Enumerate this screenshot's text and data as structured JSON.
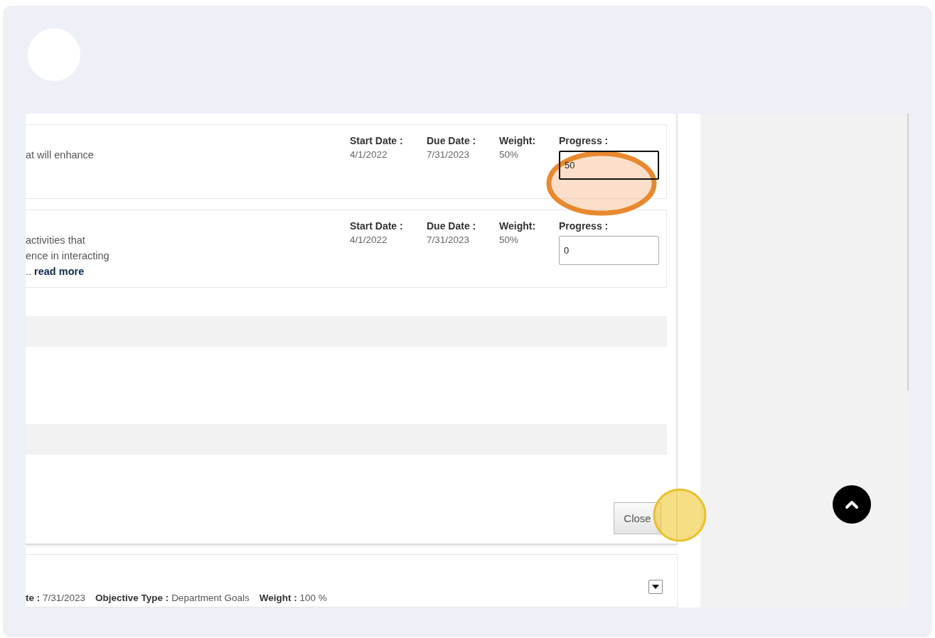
{
  "objectives": [
    {
      "description_lines": [
        "at will enhance"
      ],
      "fields": [
        {
          "label": "Start Date :",
          "value": "4/1/2022"
        },
        {
          "label": "Due Date :",
          "value": "7/31/2023"
        },
        {
          "label": "Weight:",
          "value": "50%"
        }
      ],
      "progress": {
        "label": "Progress :",
        "value": "50",
        "focused": true
      }
    },
    {
      "description_lines": [
        "activities that",
        "ence in interacting"
      ],
      "read_more": {
        "prefix": "..",
        "link": "read more"
      },
      "fields": [
        {
          "label": "Start Date :",
          "value": "4/1/2022"
        },
        {
          "label": "Due Date :",
          "value": "7/31/2023"
        },
        {
          "label": "Weight:",
          "value": "50%"
        }
      ],
      "progress": {
        "label": "Progress :",
        "value": "0",
        "focused": false
      }
    }
  ],
  "close_button": "Close",
  "next_objective": {
    "fields": [
      {
        "label": "te :",
        "value": "7/31/2023"
      },
      {
        "label": "Objective Type :",
        "value": "Department Goals"
      },
      {
        "label": "Weight :",
        "value": "100 %"
      }
    ]
  }
}
